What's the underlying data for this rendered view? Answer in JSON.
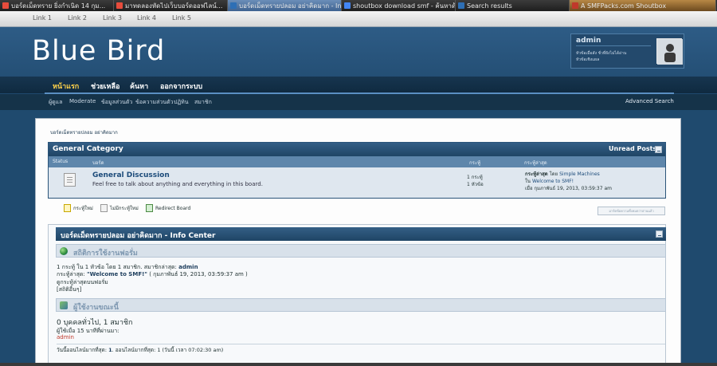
{
  "browser": {
    "tabs": [
      {
        "title": "บอร์ดเม็ดทราย ยิ่งกำเนิด 14 กุม...",
        "color": "#e74c3c"
      },
      {
        "title": "มาทดลองหัดไปเว็บบอร์ดออฟไลน์...",
        "color": "#e74c3c"
      },
      {
        "title": "บอร์ดเม็ดทรายปลอม อย่าคิดมาก - Index",
        "color": "#2e6fb5"
      },
      {
        "title": "shoutbox download smf - ค้นหาด้ว...",
        "color": "#4285f4"
      },
      {
        "title": "Search results",
        "color": "#2e6fb5"
      },
      {
        "title": "A SMFPacks.com Shoutbox",
        "color": "#c0392b"
      }
    ]
  },
  "toplinks": [
    "Link 1",
    "Link 2",
    "Link 3",
    "Link 4",
    "Link 5"
  ],
  "header": {
    "logo": "Blue Bird",
    "user": {
      "name": "admin",
      "line1": "หัวข้อเมื่อสัง ชั่วที่ยังไม่ได้อ่าน",
      "line2": "หัวข้อเชิงแผล"
    }
  },
  "nav": {
    "items": [
      "หน้าแรก",
      "ช่วยเหลือ",
      "ค้นหา",
      "ออกจากระบบ"
    ],
    "active_index": 0
  },
  "subnav": {
    "items": [
      "ผู้ดูแล",
      "Moderate",
      "ข้อมูลส่วนตัว",
      "ข้อความส่วนตัว",
      "ปฏิทิน",
      "สมาชิก"
    ],
    "advanced_search": "Advanced Search"
  },
  "breadcrumb": "บอร์ดเม็ดทรายปลอม อย่าคิดมาก",
  "category": {
    "name": "General Category",
    "unread_posts": "Unread Posts",
    "columns": [
      "Status",
      "บอร์ด",
      "กระทู้",
      "กระทู้ล่าสุด"
    ],
    "board": {
      "name": "General Discussion",
      "description": "Feel free to talk about anything and everything in this board.",
      "posts": "1 กระทู้",
      "topics": "1 หัวข้อ",
      "last_post_label": "กระทู้ล่าสุด",
      "last_post_by": "โดย",
      "last_post_author": "Simple Machines",
      "last_post_in": "ใน",
      "last_post_topic": "Welcome to SMF!",
      "last_post_date": "เมื่อ กุมภาพันธ์ 19, 2013, 03:59:37 am"
    }
  },
  "legend": {
    "new": "กระทู้ใหม่",
    "no_new": "ไม่มีกระทู้ใหม่",
    "redirect": "Redirect Board",
    "mark_read": "มาร์คข้อความทั้งหมดว่าอ่านแล้ว"
  },
  "info_center": {
    "title": "บอร์ดเม็ดทรายปลอม อย่าคิดมาก - Info Center",
    "stats": {
      "title": "สถิติการใช้งานฟอรั่ม",
      "line1_prefix": "1 กระทู้ ใน 1 หัวข้อ โดย 1 สมาชิก. สมาชิกล่าสุด:",
      "line1_member": "admin",
      "line2_prefix": "กระทู้ล่าสุด:",
      "line2_topic": "\"Welcome to SMF!\"",
      "line2_date": "( กุมภาพันธ์ 19, 2013, 03:59:37 am )",
      "line3": "ดูกระทู้ล่าสุดบนฟอรั่ม",
      "line4": "[สถิติอื่นๆ]"
    },
    "online": {
      "title": "ผู้ใช้งานขณะนี้",
      "count": "0 บุคคลทั่วไป, 1 สมาชิก",
      "recent_label": "ผู้ใช้เมื่อ 15 นาทีที่ผ่านมา:",
      "user": "admin",
      "most_online_prefix": "วันนี้ออนไลน์มากที่สุด:",
      "most_online_count": "1",
      "most_online_rest": ". ออนไลน์มากที่สุด: 1 (วันนี้ เวลา 07:02:30 am)"
    }
  },
  "colors": {
    "header_bg": "#2a5680",
    "nav_bg": "#13304a",
    "accent": "#ffd24a",
    "link": "#1c4b7a"
  }
}
